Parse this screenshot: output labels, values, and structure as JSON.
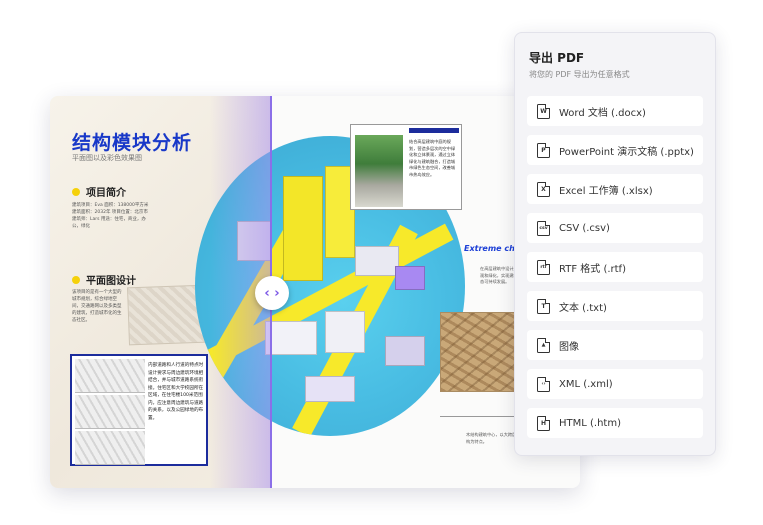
{
  "document": {
    "title": "结构模块分析",
    "subtitle": "平面图以及彩色效果图",
    "section_project": "项目简介",
    "project_text": "建筑项目：Eva 面积：138000平方米 建筑面积：2032年 项目位置：北京市 建筑师：Lars 用途：住宅，商业，办公，绿化",
    "section_plan": "平面图设计",
    "plan_text": "该项目的是有一个大型的城市规划，综合绿地空间，交通路网以及多类型的建筑，打造城市化的生态社区。",
    "frame_text": "内部道路和人行道的特点时设计要求与周边建筑环境相结合，并与城市道路系统衔接。住宅区和大学校园所在区域，在住宅楼100米范围内，应注意周边建筑与道路的关系，以及公园绿地的布置。",
    "photo_text": "结合高层建筑中庭的规划，营造多层次的空中绿化和立体景观，通过立体绿化与建筑融合，打造城市绿色生态空间，改善城市热岛效应。",
    "extreme_label": "Extreme cha",
    "extreme_text": "在高层建筑中设计立体景观和绿化，实现建筑的生态可持续发展。",
    "bottom_note": "木结构建筑中心，以大跨度木结构为特点。",
    "compare_icon": "compare-arrows-icon"
  },
  "export_panel": {
    "title": "导出 PDF",
    "subtitle": "将您的 PDF 导出为任意格式",
    "formats": [
      {
        "label": "Word 文档 (.docx)",
        "icon": "word-file-icon",
        "glyph": "W"
      },
      {
        "label": "PowerPoint 演示文稿 (.pptx)",
        "icon": "powerpoint-file-icon",
        "glyph": "P"
      },
      {
        "label": "Excel 工作簿 (.xlsx)",
        "icon": "excel-file-icon",
        "glyph": "X"
      },
      {
        "label": "CSV (.csv)",
        "icon": "csv-file-icon",
        "glyph": "csv"
      },
      {
        "label": "RTF 格式 (.rtf)",
        "icon": "rtf-file-icon",
        "glyph": "rtf"
      },
      {
        "label": "文本 (.txt)",
        "icon": "text-file-icon",
        "glyph": "T"
      },
      {
        "label": "图像",
        "icon": "image-file-icon",
        "glyph": "▲"
      },
      {
        "label": "XML (.xml)",
        "icon": "xml-file-icon",
        "glyph": "‹›"
      },
      {
        "label": "HTML (.htm)",
        "icon": "html-file-icon",
        "glyph": "H"
      }
    ]
  },
  "colors": {
    "title_blue": "#1838c8",
    "accent_purple": "#8b6fe8",
    "highlight_yellow": "#f5d10a",
    "panel_bg": "#f4f4f7"
  }
}
